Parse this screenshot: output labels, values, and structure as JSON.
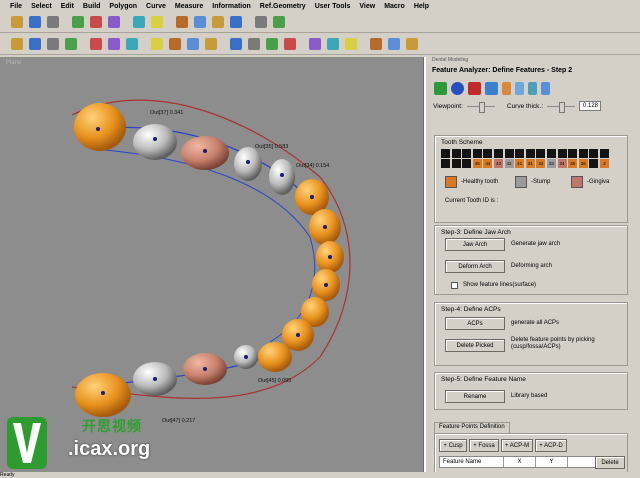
{
  "menu": [
    "File",
    "Select",
    "Edit",
    "Build",
    "Polygon",
    "Curve",
    "Measure",
    "Information",
    "Ref.Geometry",
    "User Tools",
    "View",
    "Macro",
    "Help"
  ],
  "toolbar1_icons": [
    "open-icon",
    "save-icon",
    "print-icon",
    "new-icon",
    "copy-icon",
    "paste-icon",
    "import-icon",
    "export-icon",
    "rotate-icon",
    "zoom-icon",
    "undo-icon",
    "redo-icon",
    "pointer-icon",
    "measure-icon"
  ],
  "toolbar2_icons": [
    "zoom-in-icon",
    "zoom-out-icon",
    "zoom-fit-icon",
    "pan-icon",
    "view-front-icon",
    "view-top-icon",
    "view-side-icon",
    "shaded-icon",
    "wire-icon",
    "cube-icon",
    "mesh-icon",
    "check-icon",
    "paint-icon",
    "water-icon",
    "blob-icon",
    "sphere-icon",
    "grid-icon",
    "texture-icon",
    "cloud-icon",
    "chart-icon",
    "box-icon"
  ],
  "viewport": {
    "title": "Plane",
    "labels": [
      {
        "text": "Out[37] 0.341"
      },
      {
        "text": "Out[35] 0.583"
      },
      {
        "text": "Out[34] 0.154"
      },
      {
        "text": "Out[45] 0.095"
      },
      {
        "text": "Out[47] 0.217"
      }
    ]
  },
  "panel": {
    "window_title": "Dental Modeling",
    "header": "Feature Analyzer: Define Features - Step 2",
    "viewpoint_label": "Viewpoint:",
    "curve_thick_label": "Curve thick.:",
    "curve_thick_value": "0.128",
    "tooth_scheme_label": "Tooth Scheme",
    "tooth_numbers": [
      "",
      "",
      "",
      "45",
      "44",
      "43",
      "42",
      "41",
      "31",
      "32",
      "33",
      "34",
      "35",
      "36",
      "",
      "3"
    ],
    "legend": {
      "healthy": "-Healthy tooth",
      "stump": "-Stump",
      "gingiva": "-Gingiva"
    },
    "current_tooth": "Current Tooth ID is :",
    "step3": {
      "label": "Step-3: Define Jaw Arch",
      "jaw_arch_btn": "Jaw Arch",
      "jaw_arch_desc": "Generate jaw arch",
      "deform_btn": "Deform Arch",
      "deform_desc": "Deforming arch",
      "show_lines": "Show feature lines(surface)"
    },
    "step4": {
      "label": "Step-4: Define ACPs",
      "acps_btn": "ACPs",
      "acps_desc": "generate all ACPs",
      "delete_btn": "Delete Picked",
      "delete_desc": "Delete feature points by picking (cusp/fossa/ACPs)"
    },
    "step5": {
      "label": "Step-5: Define Feature Name",
      "rename_btn": "Rename",
      "rename_desc": "Library based"
    },
    "fp_tab": "Feature Points Definition",
    "fp_buttons": [
      "+ Cusp",
      "+ Fossa",
      "+ ACP-M",
      "+ ACP-D"
    ],
    "table_headers": [
      "Feature Name",
      "X",
      "Y"
    ],
    "delete_btn": "Delete"
  },
  "watermark": {
    "cn": "开思视频",
    "url": ".icax.org"
  },
  "status": "Ready"
}
